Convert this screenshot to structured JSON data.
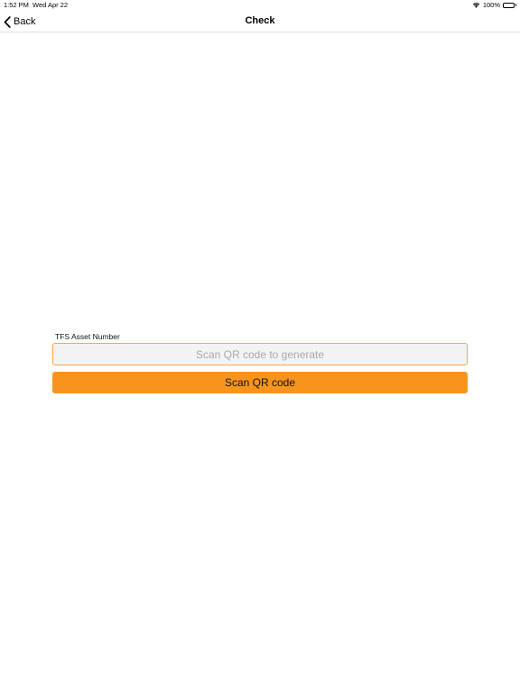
{
  "status_bar": {
    "time": "1:52 PM",
    "date": "Wed Apr 22",
    "battery_percent": "100%",
    "wifi_icon": "wifi-icon",
    "battery_icon": "battery-icon"
  },
  "nav": {
    "back_label": "Back",
    "back_icon": "chevron-left-icon",
    "title": "Check"
  },
  "form": {
    "asset_label": "TFS Asset Number",
    "asset_value": "",
    "asset_placeholder": "Scan QR code to generate",
    "scan_button_label": "Scan QR code"
  },
  "colors": {
    "accent": "#f7941d",
    "input_border": "#f7a84a",
    "input_background": "#f3f3f3"
  }
}
